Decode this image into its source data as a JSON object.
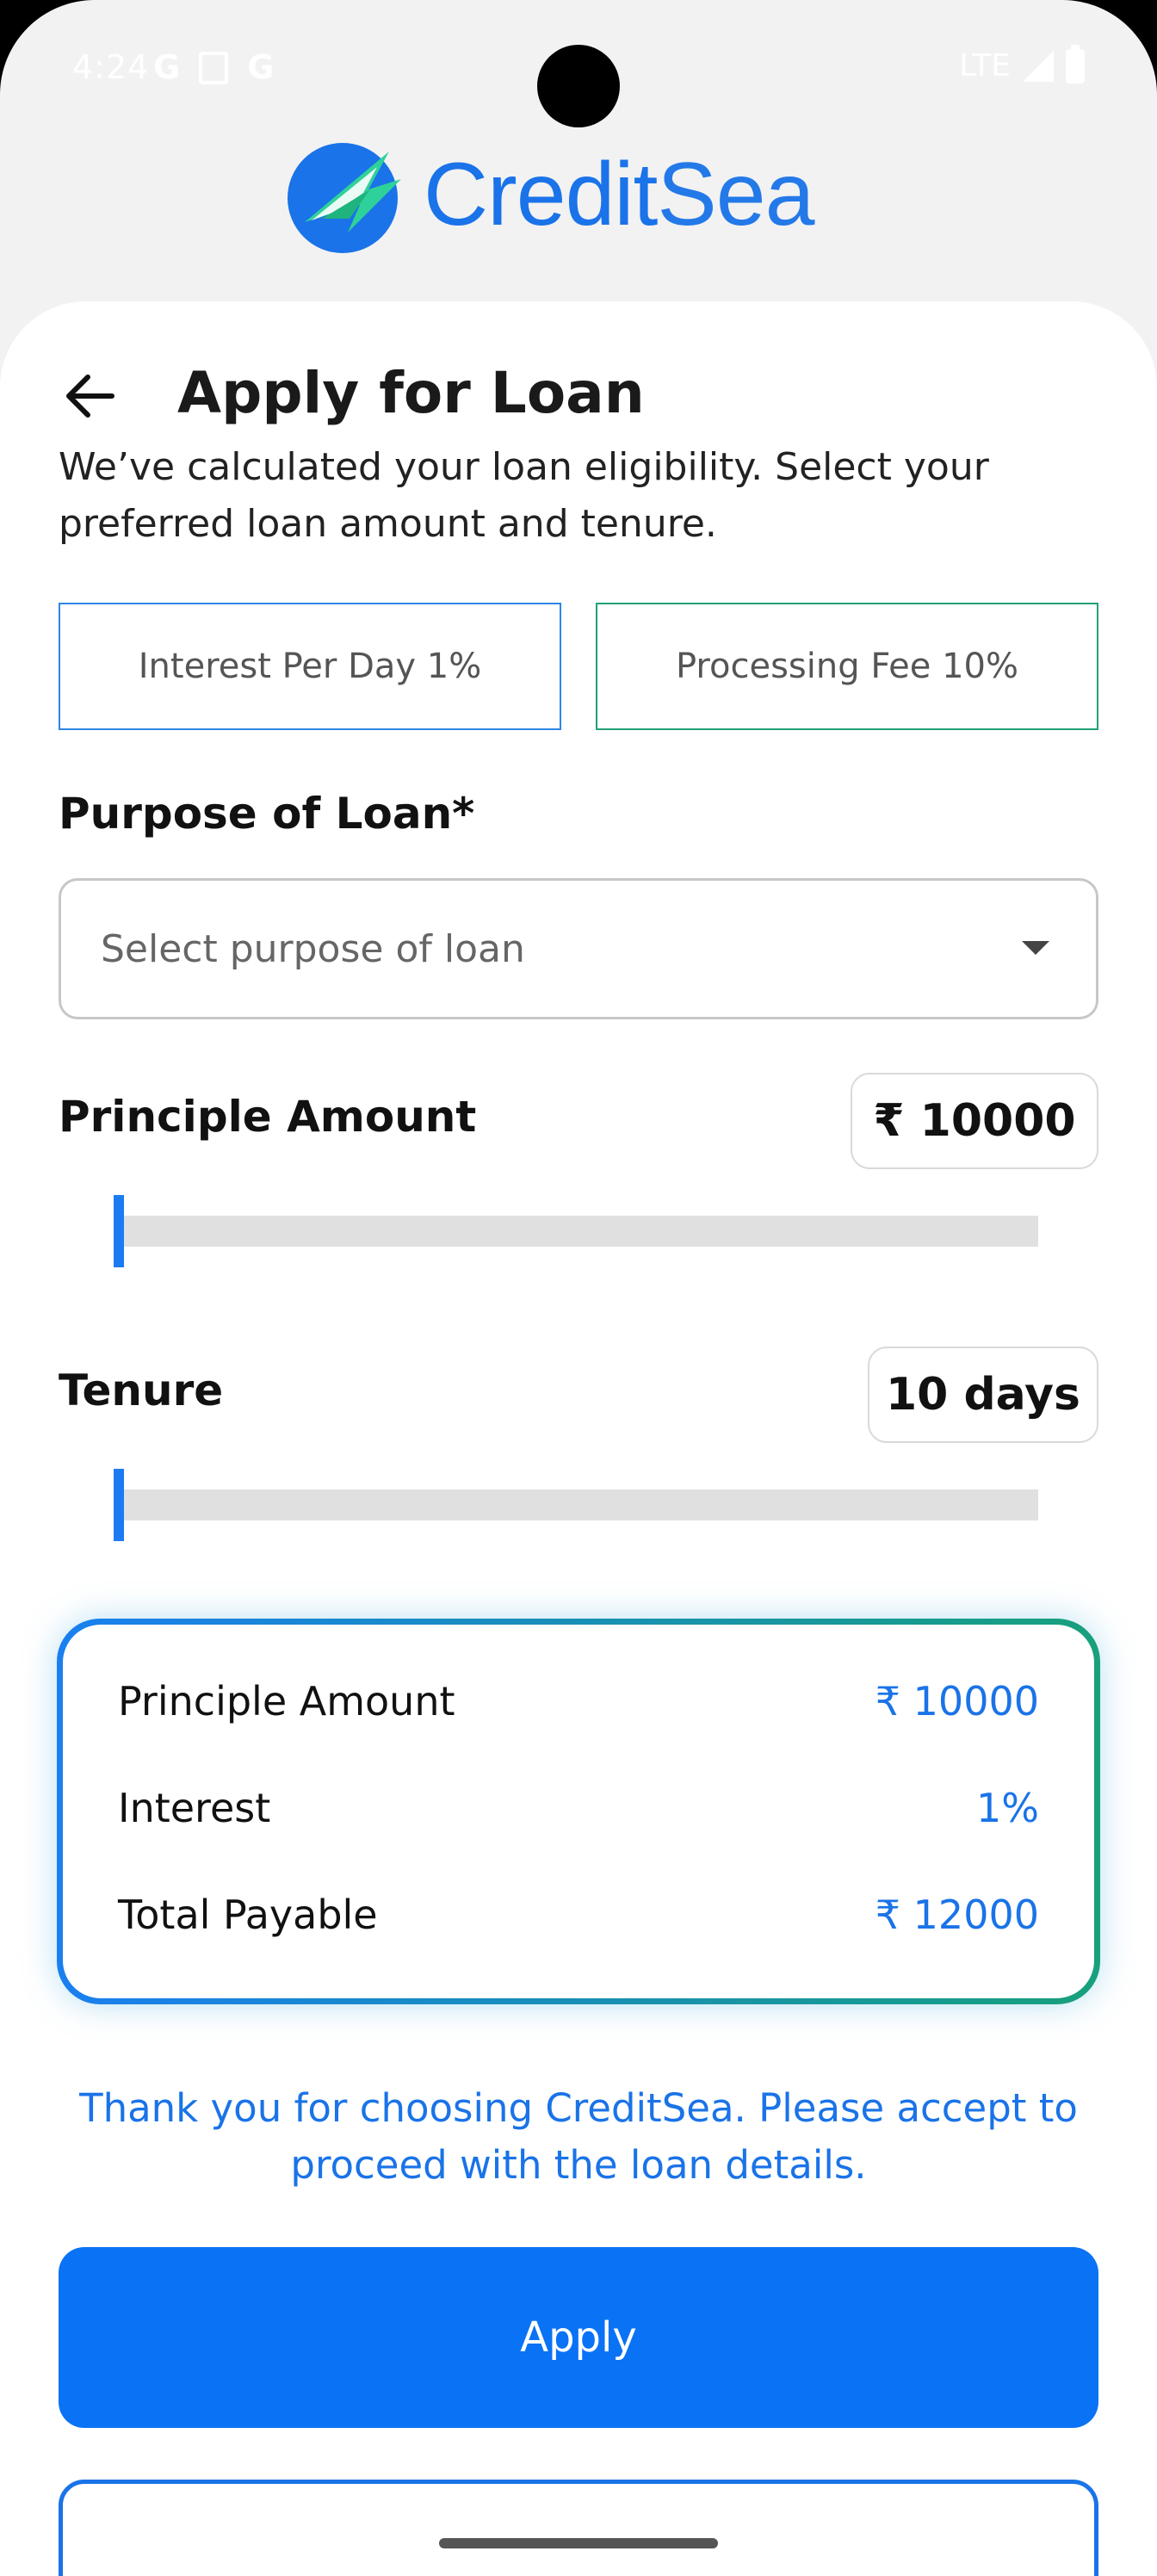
{
  "status_bar": {
    "time": "4:24",
    "left_icons": [
      "G",
      "G"
    ],
    "network": "LTE"
  },
  "logo": {
    "text_credit": "Credit",
    "text_sea": "Sea"
  },
  "header": {
    "title": "Apply for Loan",
    "subtitle": "We’ve calculated your loan eligibility. Select your preferred loan amount and tenure."
  },
  "info": {
    "interest": "Interest Per Day 1%",
    "processing_fee": "Processing Fee  10%"
  },
  "purpose": {
    "label": "Purpose of Loan*",
    "placeholder": "Select purpose of loan"
  },
  "principal": {
    "label": "Principle Amount",
    "value": "₹ 10000",
    "slider_fraction": 0.0
  },
  "tenure": {
    "label": "Tenure",
    "value": "10 days",
    "slider_fraction": 0.0
  },
  "summary": {
    "rows": [
      {
        "label": "Principle Amount",
        "value": "₹ 10000"
      },
      {
        "label": "Interest",
        "value": "1%"
      },
      {
        "label": "Total Payable",
        "value": "₹ 12000"
      }
    ]
  },
  "notice": "Thank you for choosing CreditSea. Please accept to proceed with the loan details.",
  "actions": {
    "apply": "Apply"
  },
  "colors": {
    "brand_blue": "#1a73e8",
    "button_blue": "#0a72f5",
    "accent_green": "#18a07c"
  },
  "icons": {
    "back": "arrow-left-icon",
    "dropdown": "chevron-down-icon"
  }
}
